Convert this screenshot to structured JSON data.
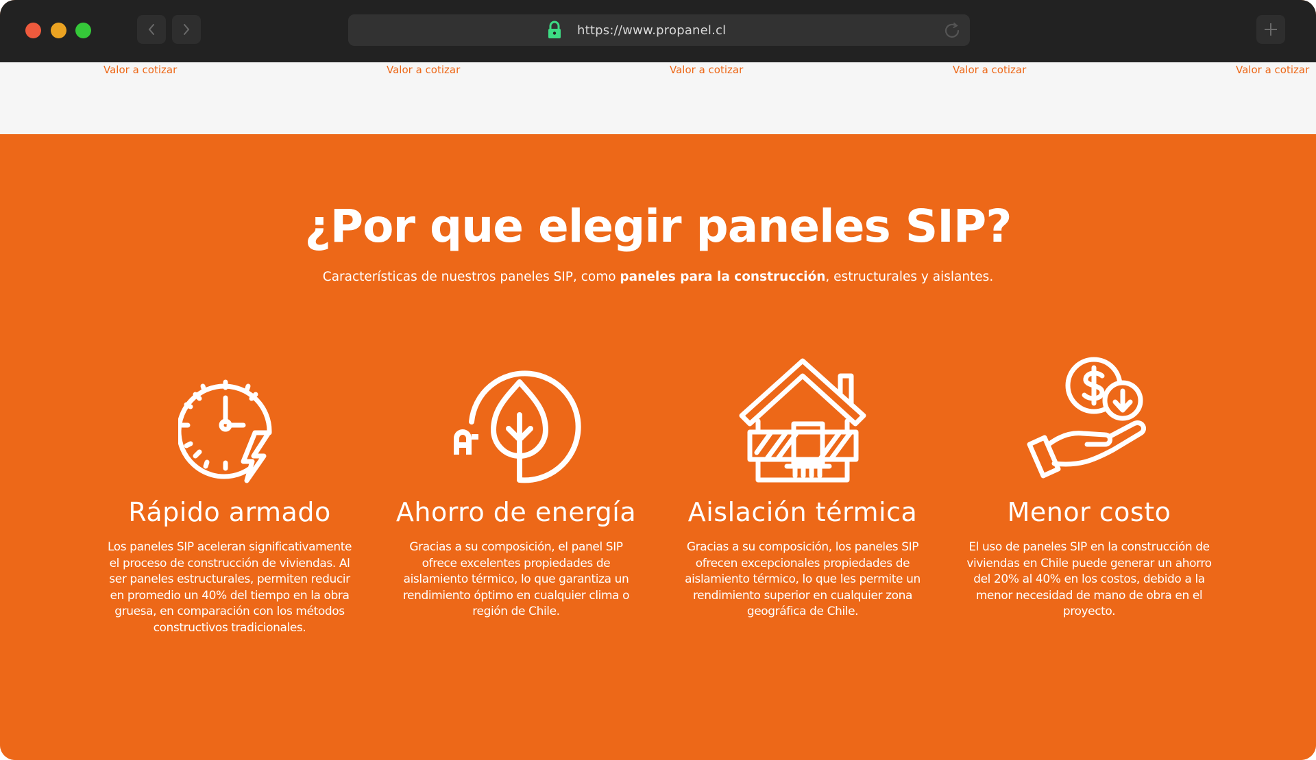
{
  "browser": {
    "url": "https://www.propanel.cl",
    "icons": [
      "back-chevron-icon",
      "forward-chevron-icon",
      "lock-icon",
      "reload-icon",
      "plus-icon"
    ]
  },
  "strip": {
    "links": [
      "Valor a cotizar",
      "Valor a cotizar",
      "Valor a cotizar",
      "Valor a cotizar",
      "Valor a cotizar"
    ]
  },
  "section": {
    "title": "¿Por que elegir paneles SIP?",
    "subtitle_pre": "Características de nuestros paneles SIP, como ",
    "subtitle_bold": "paneles para la construcción",
    "subtitle_post": ", estructurales y aislantes.",
    "features": [
      {
        "icon": "clock-lightning-icon",
        "title": "Rápido armado",
        "text": "Los paneles SIP aceleran significativamente el proceso de construcción de viviendas. Al ser paneles estructurales, permiten reducir en promedio un 40% del tiempo en la obra gruesa, en comparación con los métodos constructivos tradicionales."
      },
      {
        "icon": "leaf-energy-icon",
        "title": "Ahorro de energía",
        "text": "Gracias a su composición, el panel SIP ofrece excelentes propiedades de aislamiento térmico, lo que garantiza un rendimiento óptimo en cualquier clima o región de Chile."
      },
      {
        "icon": "house-insulation-icon",
        "title": "Aislación térmica",
        "text": "Gracias a su composición, los paneles SIP ofrecen excepcionales propiedades de aislamiento térmico, lo que les permite un rendimiento superior en cualquier zona geográfica de Chile."
      },
      {
        "icon": "hand-coin-icon",
        "title": "Menor costo",
        "text": "El uso de paneles SIP en la construcción de viviendas en Chile puede generar un ahorro del 20% al 40% en los costos, debido a la menor necesidad de mano de obra en el proyecto."
      }
    ]
  },
  "colors": {
    "accent": "#ed6818",
    "chrome": "#222222",
    "strip": "#f6f6f6",
    "lock": "#3ddc84"
  }
}
